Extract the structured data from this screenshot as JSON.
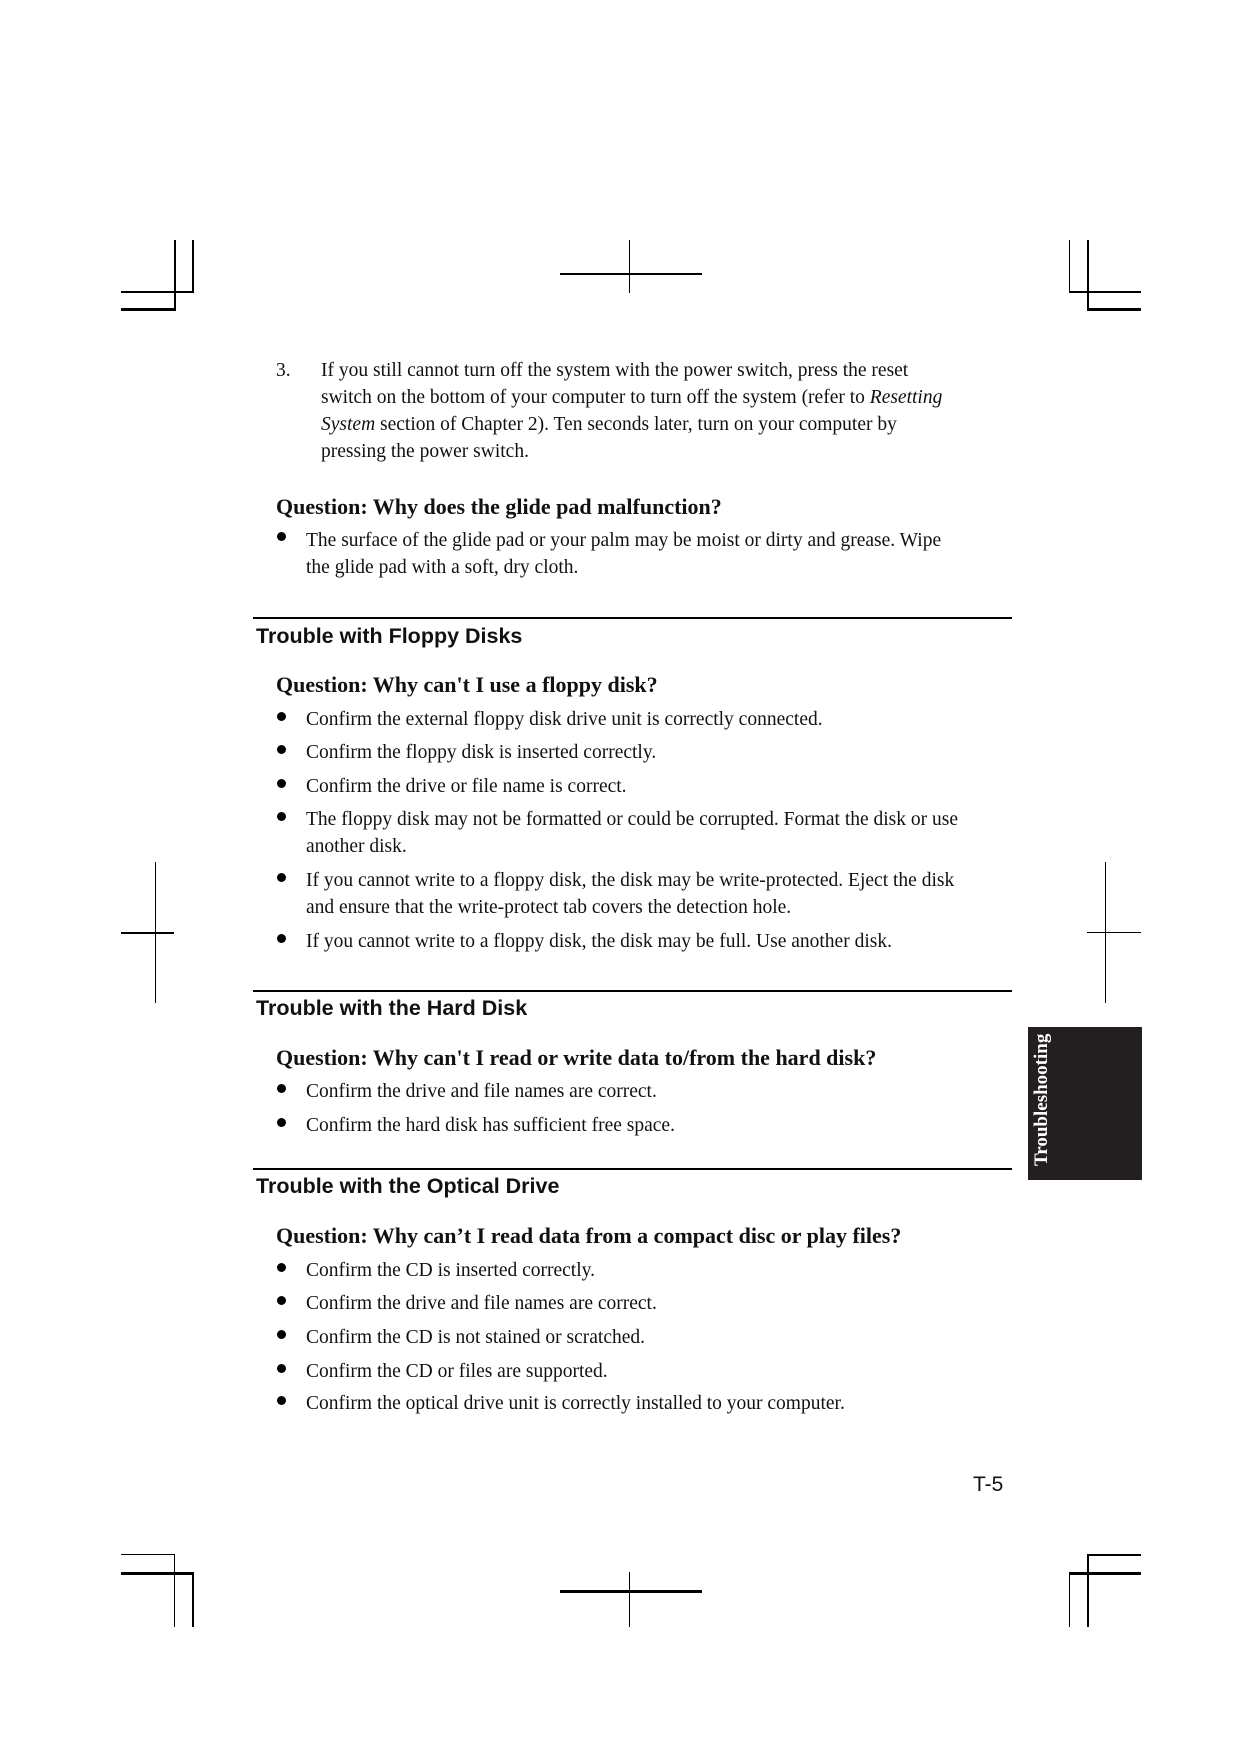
{
  "numbered_item": {
    "number": "3.",
    "lines": [
      {
        "pre": "If you still cannot turn off the system with the power switch, press the reset",
        "italic": "",
        "post": ""
      },
      {
        "pre": "switch on the bottom of your computer to turn off the system (refer to ",
        "italic": "Resetting",
        "post": ""
      },
      {
        "pre": "",
        "italic": "System",
        "post": " section of Chapter 2). Ten seconds later, turn on your computer by"
      },
      {
        "pre": "pressing the power switch.",
        "italic": "",
        "post": ""
      }
    ]
  },
  "glide_pad": {
    "question": "Question: Why does the glide pad malfunction?",
    "bullets": [
      {
        "lines": [
          "The surface of the glide pad or your palm may be moist or dirty and grease. Wipe",
          "the glide pad with a soft, dry cloth."
        ]
      }
    ]
  },
  "floppy": {
    "heading": "Trouble with Floppy Disks",
    "question": "Question: Why can't I use a floppy disk?",
    "bullets": [
      {
        "lines": [
          "Confirm the external floppy disk drive unit is correctly connected."
        ]
      },
      {
        "lines": [
          "Confirm the floppy disk is inserted correctly."
        ]
      },
      {
        "lines": [
          "Confirm the drive or file name is correct."
        ]
      },
      {
        "lines": [
          "The floppy disk may not be formatted or could be corrupted. Format the disk or use",
          "another disk."
        ]
      },
      {
        "lines": [
          "If you cannot write to a floppy disk, the disk may be write-protected. Eject the disk",
          "and ensure that the write-protect tab covers the detection hole."
        ]
      },
      {
        "lines": [
          "If you cannot write to a floppy disk, the disk may be full. Use another disk."
        ]
      }
    ]
  },
  "hard_disk": {
    "heading": "Trouble with the Hard Disk",
    "question": "Question: Why can't I read or write data to/from the hard disk?",
    "bullets": [
      {
        "lines": [
          "Confirm the drive and file names are correct."
        ]
      },
      {
        "lines": [
          "Confirm the hard disk has sufficient free space."
        ]
      }
    ]
  },
  "optical": {
    "heading": "Trouble with the Optical Drive",
    "question": "Question: Why can’t I read data from a compact disc or play files?",
    "bullets": [
      {
        "lines": [
          "Confirm the CD is inserted correctly."
        ]
      },
      {
        "lines": [
          "Confirm the drive and file names are correct."
        ]
      },
      {
        "lines": [
          "Confirm the CD is not stained or scratched."
        ]
      },
      {
        "lines": [
          "Confirm the CD or files are supported."
        ]
      },
      {
        "lines": [
          "Confirm the optical drive unit is correctly installed to your computer."
        ]
      }
    ]
  },
  "side_tab": {
    "label": "Troubleshooting",
    "background": "#231f20",
    "text_color": "#ffffff"
  },
  "page_number": "T-5"
}
